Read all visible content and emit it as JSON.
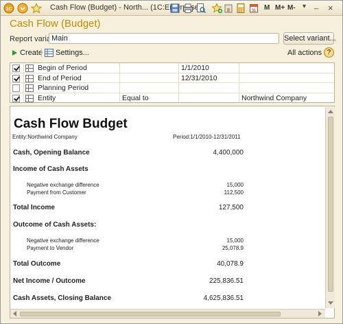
{
  "window": {
    "title": "Cash Flow (Budget) - North... (1C:Enterprise)",
    "m_buttons": [
      "M",
      "M+",
      "M-"
    ],
    "minimize": "_",
    "close": "×"
  },
  "form": {
    "title": "Cash Flow (Budget)",
    "report_variant_label": "Report variant:",
    "report_variant_value": "Main",
    "select_variant_label": "Select variant..."
  },
  "commands": {
    "create_label": "Create",
    "settings_label": "Settings...",
    "all_actions_label": "All actions",
    "help_label": "?"
  },
  "settings_rows": [
    {
      "checked": true,
      "name": "Begin of Period",
      "condition": "",
      "value": "1/1/2010"
    },
    {
      "checked": true,
      "name": "End of Period",
      "condition": "",
      "value": "12/31/2010"
    },
    {
      "checked": false,
      "name": "Planning Period",
      "condition": "",
      "value": ""
    },
    {
      "checked": true,
      "name": "Entity",
      "condition": "Equal to",
      "value": "Northwind Company"
    }
  ],
  "report": {
    "title": "Cash Flow Budget",
    "entity": "Entity:Northwind Company",
    "period": "Period:1/1/2010-12/31/2011",
    "opening_label": "Cash, Opening Balance",
    "opening_value": "4,400,000",
    "income_header": "Income of Cash Assets",
    "income_rows": [
      {
        "label": "Negative exchange difference",
        "value": "15,000"
      },
      {
        "label": "Payment from Customer",
        "value": "112,500"
      }
    ],
    "total_income_label": "Total Income",
    "total_income_value": "127,500",
    "outcome_header": "Outcome of Cash Assets:",
    "outcome_rows": [
      {
        "label": "Negative exchange difference",
        "value": "15,000"
      },
      {
        "label": "Payment to Vendor",
        "value": "25,078.9"
      }
    ],
    "total_outcome_label": "Total Outcome",
    "total_outcome_value": "40,078.9",
    "net_label": "Net Income / Outcome",
    "net_value": "225,836.51",
    "closing_label": "Cash Assets, Closing Balance",
    "closing_value": "4,625,836.51"
  }
}
